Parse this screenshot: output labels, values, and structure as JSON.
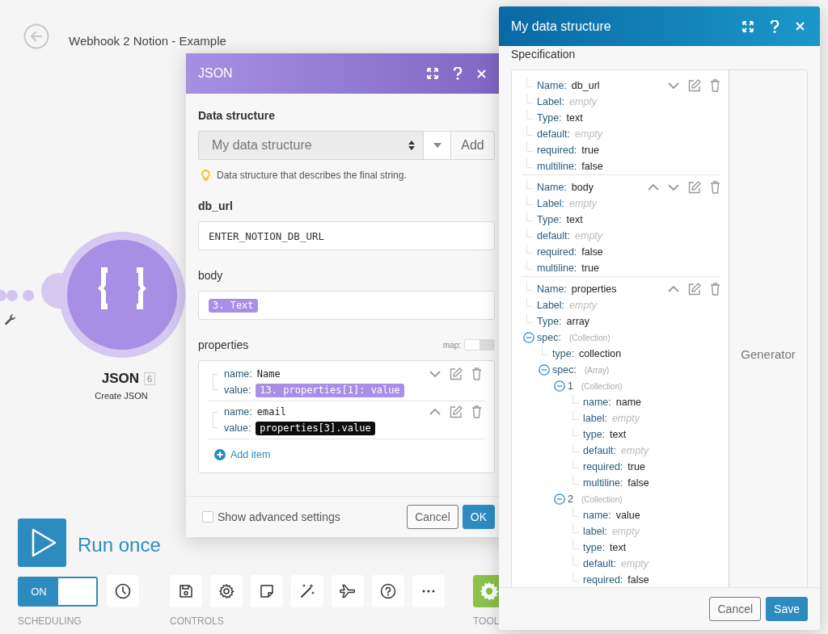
{
  "canvas": {
    "title": "Webhook 2 Notion - Example"
  },
  "module": {
    "name": "JSON",
    "number": "6",
    "subtitle": "Create JSON"
  },
  "run_once": {
    "label": "Run once"
  },
  "scheduling": {
    "label": "SCHEDULING",
    "toggle": {
      "on": true,
      "label": "ON"
    }
  },
  "controls": {
    "label": "CONTROLS"
  },
  "tools": {
    "label": "TOOL"
  },
  "json_dialog": {
    "title": "JSON",
    "data_structure": {
      "label": "Data structure",
      "value": "My data structure",
      "add": "Add",
      "hint": "Data structure that describes the final string."
    },
    "fields": [
      {
        "label": "db_url",
        "required": true,
        "kind": "text",
        "value": "ENTER_NOTION_DB_URL"
      },
      {
        "label": "body",
        "required": false,
        "kind": "tokens",
        "tokens": [
          {
            "text": "3. Text",
            "kind": "mapped"
          }
        ]
      }
    ],
    "properties": {
      "label": "properties",
      "map_label": "map:",
      "map_on": false,
      "add_item": "Add item",
      "items": [
        {
          "name_key": "name:",
          "name": "Name",
          "value_key": "value:",
          "value": {
            "text": "13. properties[1]: value",
            "kind": "mapped"
          },
          "can_move_up": false,
          "can_move_down": true
        },
        {
          "name_key": "name:",
          "name": "email",
          "value_key": "value:",
          "value": {
            "text": "properties[3].value",
            "kind": "raw"
          },
          "can_move_up": true,
          "can_move_down": false
        }
      ]
    },
    "advanced": {
      "label": "Show advanced settings",
      "checked": false
    },
    "buttons": {
      "cancel": "Cancel",
      "ok": "OK"
    }
  },
  "structure_dialog": {
    "title": "My data structure",
    "spec_label": "Specification",
    "generator": "Generator",
    "items": [
      {
        "can_move_up": false,
        "can_move_down": true,
        "tree": [
          {
            "kind": "row",
            "key": "Name:",
            "value": "db_url",
            "empty": false
          },
          {
            "kind": "row",
            "key": "Label:",
            "value": "empty",
            "empty": true
          },
          {
            "kind": "row",
            "key": "Type:",
            "value": "text",
            "empty": false
          },
          {
            "kind": "row",
            "key": "default:",
            "value": "empty",
            "empty": true
          },
          {
            "kind": "row",
            "key": "required:",
            "value": "true",
            "empty": false
          },
          {
            "kind": "row",
            "key": "multiline:",
            "value": "false",
            "empty": false
          }
        ]
      },
      {
        "can_move_up": true,
        "can_move_down": true,
        "tree": [
          {
            "kind": "row",
            "key": "Name:",
            "value": "body",
            "empty": false
          },
          {
            "kind": "row",
            "key": "Label:",
            "value": "empty",
            "empty": true
          },
          {
            "kind": "row",
            "key": "Type:",
            "value": "text",
            "empty": false
          },
          {
            "kind": "row",
            "key": "default:",
            "value": "empty",
            "empty": true
          },
          {
            "kind": "row",
            "key": "required:",
            "value": "false",
            "empty": false
          },
          {
            "kind": "row",
            "key": "multiline:",
            "value": "true",
            "empty": false
          }
        ]
      },
      {
        "can_move_up": true,
        "can_move_down": false,
        "tree": [
          {
            "kind": "row",
            "key": "Name:",
            "value": "properties",
            "empty": false
          },
          {
            "kind": "row",
            "key": "Label:",
            "value": "empty",
            "empty": true
          },
          {
            "kind": "row",
            "key": "Type:",
            "value": "array",
            "empty": false
          },
          {
            "kind": "group",
            "key": "spec:",
            "hint": "(Collection)",
            "expanded": true,
            "children": [
              {
                "kind": "row",
                "key": "type:",
                "value": "collection",
                "empty": false
              },
              {
                "kind": "group",
                "key": "spec:",
                "hint": "(Array)",
                "expanded": true,
                "children": [
                  {
                    "kind": "group",
                    "key": "1",
                    "hint": "(Collection)",
                    "expanded": true,
                    "children": [
                      {
                        "kind": "row",
                        "key": "name:",
                        "value": "name",
                        "empty": false
                      },
                      {
                        "kind": "row",
                        "key": "label:",
                        "value": "empty",
                        "empty": true
                      },
                      {
                        "kind": "row",
                        "key": "type:",
                        "value": "text",
                        "empty": false
                      },
                      {
                        "kind": "row",
                        "key": "default:",
                        "value": "empty",
                        "empty": true
                      },
                      {
                        "kind": "row",
                        "key": "required:",
                        "value": "true",
                        "empty": false
                      },
                      {
                        "kind": "row",
                        "key": "multiline:",
                        "value": "false",
                        "empty": false
                      }
                    ]
                  },
                  {
                    "kind": "group",
                    "key": "2",
                    "hint": "(Collection)",
                    "expanded": true,
                    "children": [
                      {
                        "kind": "row",
                        "key": "name:",
                        "value": "value",
                        "empty": false
                      },
                      {
                        "kind": "row",
                        "key": "label:",
                        "value": "empty",
                        "empty": true
                      },
                      {
                        "kind": "row",
                        "key": "type:",
                        "value": "text",
                        "empty": false
                      },
                      {
                        "kind": "row",
                        "key": "default:",
                        "value": "empty",
                        "empty": true
                      },
                      {
                        "kind": "row",
                        "key": "required:",
                        "value": "false",
                        "empty": false
                      }
                    ]
                  }
                ]
              }
            ]
          }
        ]
      }
    ],
    "buttons": {
      "cancel": "Cancel",
      "save": "Save"
    }
  }
}
